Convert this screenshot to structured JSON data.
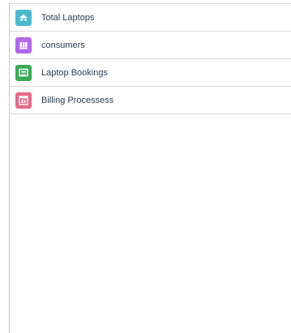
{
  "nav": {
    "items": [
      {
        "label": "Total Laptops",
        "icon": "laptop-icon",
        "color": "#4bb8d1"
      },
      {
        "label": "consumers",
        "icon": "people-icon",
        "color": "#b266e8"
      },
      {
        "label": "Laptop Bookings",
        "icon": "booking-icon",
        "color": "#3aaa55"
      },
      {
        "label": "Billing Processess",
        "icon": "billing-icon",
        "color": "#e8678c"
      }
    ]
  }
}
